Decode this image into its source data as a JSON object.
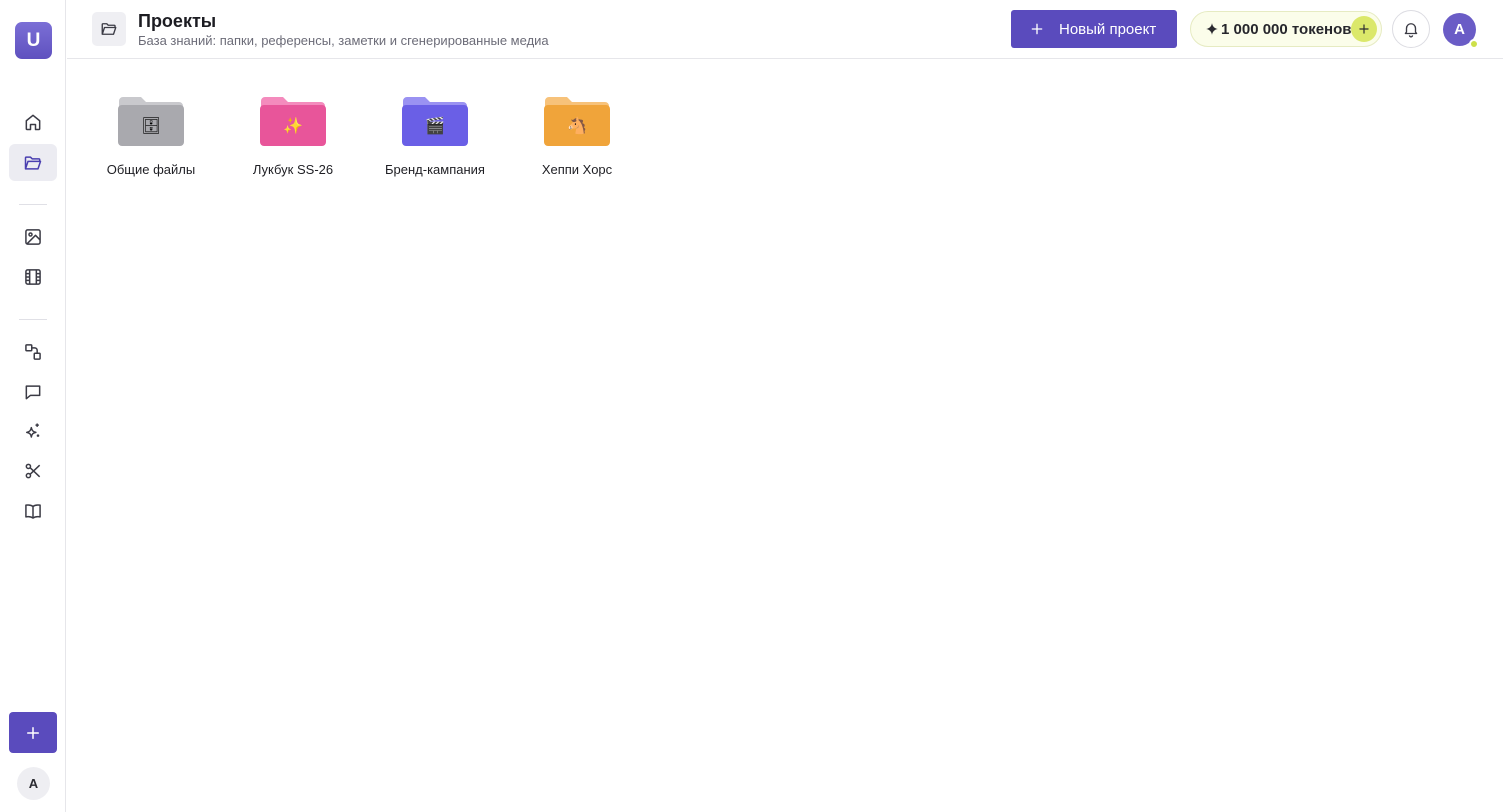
{
  "app": {
    "logo_letter": "U"
  },
  "header": {
    "title": "Проекты",
    "subtitle": "База знаний: папки, референсы, заметки и сгенерированные медиа",
    "new_project_label": "Новый проект",
    "tokens_label": "1 000 000 токенов",
    "avatar_letter": "A"
  },
  "sidebar": {
    "items": [
      {
        "name": "home",
        "icon": "home-icon"
      },
      {
        "name": "projects",
        "icon": "folder-open-icon",
        "active": true
      },
      {
        "name": "images",
        "icon": "image-icon"
      },
      {
        "name": "video",
        "icon": "film-icon"
      },
      {
        "name": "workflows",
        "icon": "workflow-icon"
      },
      {
        "name": "chat",
        "icon": "chat-icon"
      },
      {
        "name": "ai-tools",
        "icon": "sparkles-icon"
      },
      {
        "name": "edit",
        "icon": "scissors-icon"
      },
      {
        "name": "library",
        "icon": "book-icon"
      }
    ],
    "avatar_letter": "A"
  },
  "folders": [
    {
      "label": "Общие файлы",
      "color": "#a9a9ae",
      "tab": "#c9c9cd",
      "emblem": "🗄"
    },
    {
      "label": "Лукбук SS-26",
      "color": "#e8559a",
      "tab": "#f48bbd",
      "emblem": "✨"
    },
    {
      "label": "Бренд-кампания",
      "color": "#6a5fe6",
      "tab": "#9a92f2",
      "emblem": "🎬"
    },
    {
      "label": "Хеппи Хорс",
      "color": "#f0a43a",
      "tab": "#f7c27a",
      "emblem": "🐴"
    }
  ],
  "colors": {
    "accent": "#5a4bbd",
    "token_bg": "#fbfdea",
    "token_add": "#dbe86a"
  }
}
